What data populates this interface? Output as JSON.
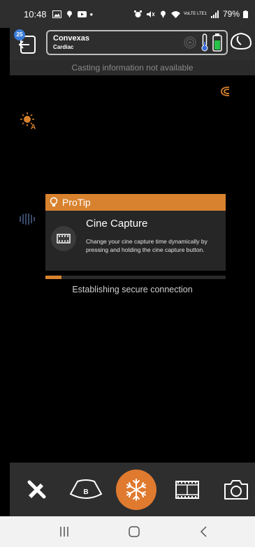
{
  "status_bar": {
    "time": "10:48",
    "battery": "79%",
    "network": "VoLTE LTE1"
  },
  "header": {
    "notification_count": "25",
    "probe_name": "Convexas",
    "preset_name": "Cardiac"
  },
  "casting_status": "Casting information not available",
  "protip": {
    "header": "ProTip",
    "title": "Cine Capture",
    "text": "Change your cine capture time dynamically by pressing and holding the cine capture button."
  },
  "connection": {
    "status_text": "Establishing secure connection",
    "progress_fraction": 0.09
  },
  "toolbar": {
    "b_mode_label": "B"
  },
  "colors": {
    "accent": "#e07a2f",
    "panel": "#2e2e2e",
    "background": "#000000"
  },
  "icons": [
    "tools-icon",
    "b-mode-icon",
    "freeze-icon",
    "cine-capture-icon",
    "camera-icon"
  ]
}
